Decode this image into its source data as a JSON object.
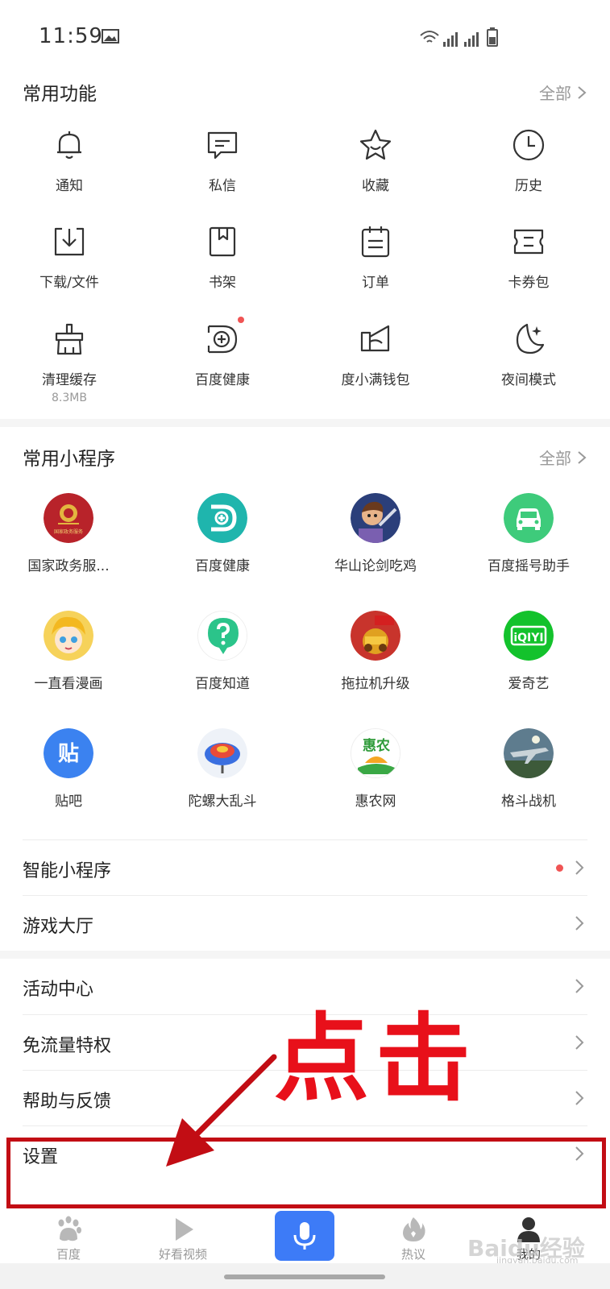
{
  "status": {
    "time": "11:59"
  },
  "common_functions": {
    "title": "常用功能",
    "more": "全部",
    "items": [
      {
        "label": "通知"
      },
      {
        "label": "私信"
      },
      {
        "label": "收藏"
      },
      {
        "label": "历史"
      },
      {
        "label": "下载/文件"
      },
      {
        "label": "书架"
      },
      {
        "label": "订单"
      },
      {
        "label": "卡券包"
      },
      {
        "label": "清理缓存",
        "sub": "8.3MB"
      },
      {
        "label": "百度健康"
      },
      {
        "label": "度小满钱包"
      },
      {
        "label": "夜间模式"
      }
    ]
  },
  "mini_programs": {
    "title": "常用小程序",
    "more": "全部",
    "items": [
      {
        "label": "国家政务服..."
      },
      {
        "label": "百度健康"
      },
      {
        "label": "华山论剑吃鸡"
      },
      {
        "label": "百度摇号助手"
      },
      {
        "label": "一直看漫画"
      },
      {
        "label": "百度知道"
      },
      {
        "label": "拖拉机升级"
      },
      {
        "label": "爱奇艺"
      },
      {
        "label": "贴吧"
      },
      {
        "label": "陀螺大乱斗"
      },
      {
        "label": "惠农网"
      },
      {
        "label": "格斗战机"
      }
    ]
  },
  "list_rows": [
    {
      "label": "智能小程序"
    },
    {
      "label": "游戏大厅"
    },
    {
      "label": "活动中心"
    },
    {
      "label": "免流量特权"
    },
    {
      "label": "帮助与反馈"
    },
    {
      "label": "设置"
    }
  ],
  "annotation": {
    "text": "点击",
    "color": "#e8101a"
  },
  "icon_text": {
    "gov_seal": "国家政务服务",
    "tieba": "贴",
    "huinong": "惠农",
    "iqiyi": "iQIYI"
  },
  "tabs": [
    {
      "label": "百度"
    },
    {
      "label": "好看视频"
    },
    {
      "label": "热议"
    },
    {
      "label": "我的"
    }
  ],
  "watermark": {
    "text": "Baidu经验",
    "sub": "jingyan.baidu.com"
  },
  "colors": {
    "accent": "#3d7bf7",
    "badge": "#f05454",
    "highlight": "#c20d14"
  }
}
